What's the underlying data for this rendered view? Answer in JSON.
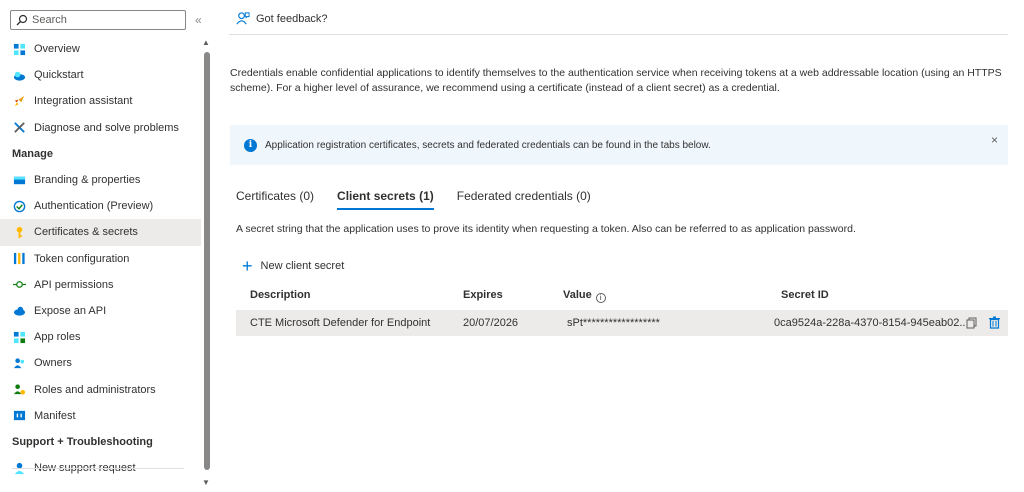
{
  "sidebar": {
    "search_placeholder": "Search",
    "collapse_glyph": "«",
    "items": [
      {
        "label": "Overview",
        "icon": "overview-icon"
      },
      {
        "label": "Quickstart",
        "icon": "quickstart-icon"
      },
      {
        "label": "Integration assistant",
        "icon": "rocket-icon"
      },
      {
        "label": "Diagnose and solve problems",
        "icon": "wrench-icon"
      }
    ],
    "manage_header": "Manage",
    "manage_items": [
      {
        "label": "Branding & properties",
        "icon": "branding-icon"
      },
      {
        "label": "Authentication (Preview)",
        "icon": "authentication-icon"
      },
      {
        "label": "Certificates & secrets",
        "icon": "key-icon",
        "active": true
      },
      {
        "label": "Token configuration",
        "icon": "token-icon"
      },
      {
        "label": "API permissions",
        "icon": "api-permissions-icon"
      },
      {
        "label": "Expose an API",
        "icon": "cloud-icon"
      },
      {
        "label": "App roles",
        "icon": "app-roles-icon"
      },
      {
        "label": "Owners",
        "icon": "owners-icon"
      },
      {
        "label": "Roles and administrators",
        "icon": "roles-icon"
      },
      {
        "label": "Manifest",
        "icon": "manifest-icon"
      }
    ],
    "support_header": "Support + Troubleshooting",
    "support_items": [
      {
        "label": "New support request",
        "icon": "support-icon"
      }
    ]
  },
  "main": {
    "feedback_label": "Got feedback?",
    "description": "Credentials enable confidential applications to identify themselves to the authentication service when receiving tokens at a web addressable location (using an HTTPS scheme). For a higher level of assurance, we recommend using a certificate (instead of a client secret) as a credential.",
    "banner_text": "Application registration certificates, secrets and federated credentials can be found in the tabs below.",
    "banner_close": "×",
    "tabs": [
      {
        "label": "Certificates (0)"
      },
      {
        "label": "Client secrets (1)",
        "active": true
      },
      {
        "label": "Federated credentials (0)"
      }
    ],
    "tab_description": "A secret string that the application uses to prove its identity when requesting a token. Also can be referred to as application password.",
    "new_secret_label": "New client secret",
    "table": {
      "headers": [
        "Description",
        "Expires",
        "Value",
        "Secret ID"
      ],
      "value_info_glyph": "i",
      "rows": [
        {
          "description": "CTE Microsoft Defender for Endpoint",
          "expires": "20/07/2026",
          "value": "sPt******************",
          "secret_id": "0ca9524a-228a-4370-8154-945eab02..."
        }
      ]
    }
  },
  "colors": {
    "accent": "#0078d4",
    "active_bg": "#edebe9",
    "banner_bg": "#eff6fc"
  }
}
